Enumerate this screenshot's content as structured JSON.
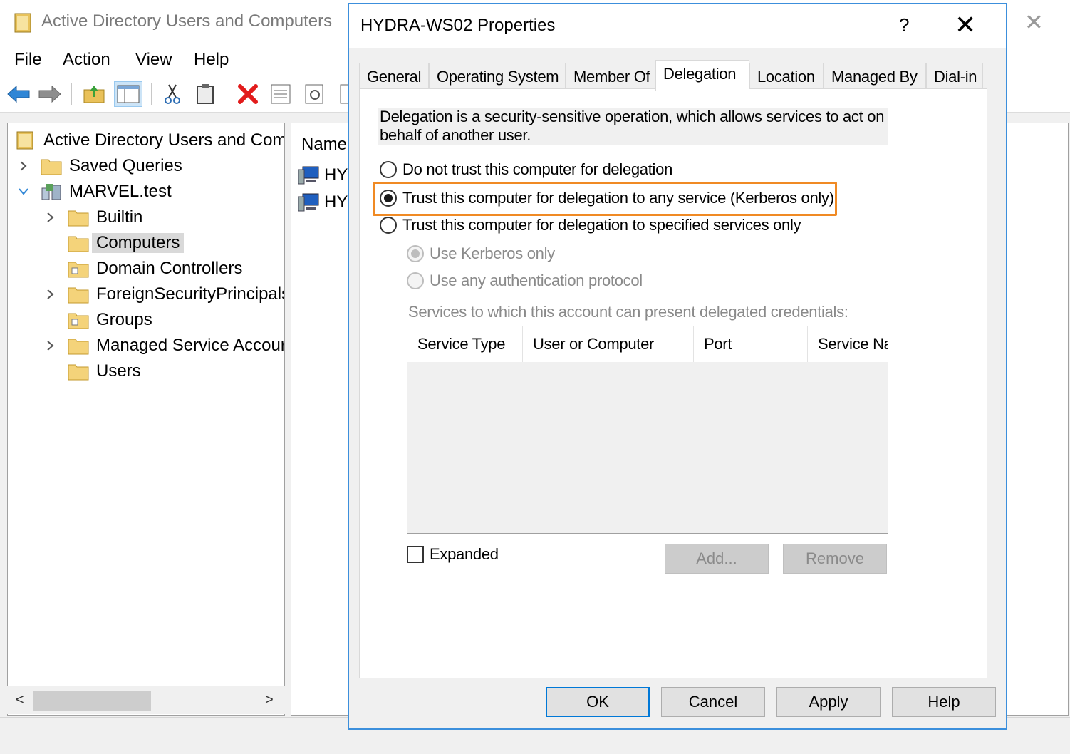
{
  "main_window": {
    "title": "Active Directory Users and Computers",
    "menu": [
      "File",
      "Action",
      "View",
      "Help"
    ],
    "toolbar_icons": [
      "back-arrow-icon",
      "forward-arrow-icon",
      "up-folder-icon",
      "show-console-tree-icon",
      "cut-icon",
      "paste-icon",
      "delete-icon",
      "properties-icon",
      "refresh-icon",
      "export-list-icon"
    ]
  },
  "tree": {
    "root": "Active Directory Users and Com",
    "items": [
      {
        "label": "Saved Queries",
        "expander": "collapsed"
      },
      {
        "label": "MARVEL.test",
        "expander": "expanded"
      },
      {
        "label": "Builtin",
        "expander": "collapsed"
      },
      {
        "label": "Computers",
        "expander": "none",
        "selected": true
      },
      {
        "label": "Domain Controllers",
        "expander": "none"
      },
      {
        "label": "ForeignSecurityPrincipals",
        "expander": "collapsed"
      },
      {
        "label": "Groups",
        "expander": "none"
      },
      {
        "label": "Managed Service Accour",
        "expander": "collapsed"
      },
      {
        "label": "Users",
        "expander": "none"
      }
    ]
  },
  "list": {
    "column_name": "Name",
    "rows": [
      "HY",
      "HY"
    ]
  },
  "dialog": {
    "title": "HYDRA-WS02 Properties",
    "help_glyph": "?",
    "tabs": [
      "General",
      "Operating System",
      "Member Of",
      "Delegation",
      "Location",
      "Managed By",
      "Dial-in"
    ],
    "active_tab": "Delegation",
    "description": "Delegation is a security-sensitive operation, which allows services to act on behalf of another user.",
    "options": [
      "Do not trust this computer for delegation",
      "Trust this computer for delegation to any service (Kerberos only)",
      "Trust this computer for delegation to specified services only"
    ],
    "selected_option": 1,
    "sub_options": [
      "Use Kerberos only",
      "Use any authentication protocol"
    ],
    "services_label": "Services to which this account can present delegated credentials:",
    "columns": [
      "Service Type",
      "User or Computer",
      "Port",
      "Service Na"
    ],
    "expanded_label": "Expanded",
    "add_button": "Add...",
    "remove_button": "Remove",
    "buttons": {
      "ok": "OK",
      "cancel": "Cancel",
      "apply": "Apply",
      "help": "Help"
    },
    "highlight_color": "#f08a24",
    "accent_color": "#0078d7"
  }
}
